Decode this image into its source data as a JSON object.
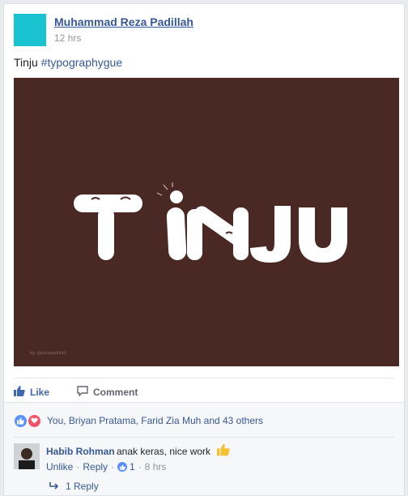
{
  "post": {
    "author": "Muhammad Reza Padillah",
    "timestamp": "12 hrs",
    "text": "Tinju",
    "hashtag": "#typographygue",
    "image": {
      "word": "TINJU",
      "credit": "by: @rezapadillah",
      "bg_color": "#4a2823"
    }
  },
  "actions": {
    "like": "Like",
    "comment": "Comment"
  },
  "reactions": {
    "summary": "You, Briyan Pratama, Farid Zia Muh and 43 others"
  },
  "comments": [
    {
      "author": "Habib Rohman",
      "text": "anak keras, nice work",
      "emoji": "👍",
      "unlike": "Unlike",
      "reply": "Reply",
      "likes": "1",
      "time": "8 hrs"
    }
  ],
  "replies": {
    "label": "1 Reply"
  },
  "colors": {
    "link": "#365899",
    "accent": "#4267b2",
    "avatar": "#19c3cf"
  }
}
